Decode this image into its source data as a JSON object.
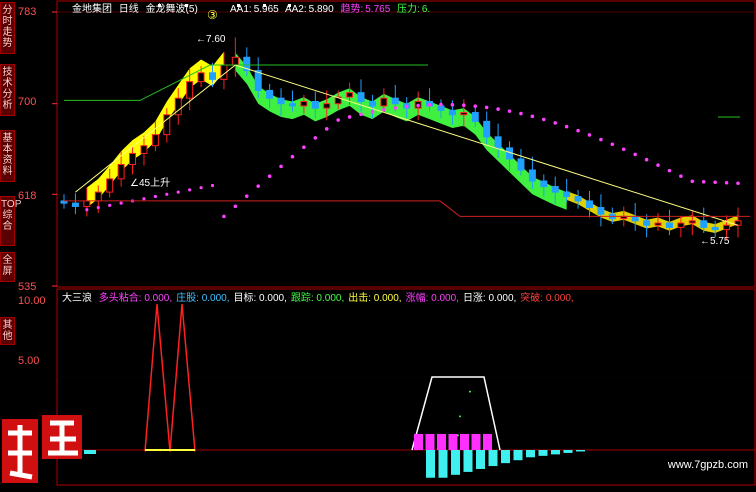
{
  "sidebar": {
    "tabs": [
      {
        "id": "fenshi",
        "label": "分时走势"
      },
      {
        "id": "jishu",
        "label": "技术分析"
      },
      {
        "id": "jiben",
        "label": "基本资料"
      },
      {
        "id": "top",
        "label": "TOP综合"
      },
      {
        "id": "quanping",
        "label": "全屏"
      },
      {
        "id": "qita",
        "label": "其他"
      }
    ]
  },
  "main_header": {
    "stock": "金地集团",
    "period": "日线",
    "indicator": "金龙舞波(5)",
    "aa1_label": "AA1:",
    "aa1_value": "5.965",
    "aa2_label": "AA2:",
    "aa2_value": "5.890",
    "trend_label": "趋势:",
    "trend_value": "5.765",
    "pressure_label": "压力:",
    "pressure_value": "6."
  },
  "sub_header": {
    "name": "大三浪",
    "items": [
      {
        "label": "多头粘合:",
        "value": "0.000",
        "color": "#ff40ff"
      },
      {
        "label": "庄股:",
        "value": "0.000",
        "color": "#40c0ff"
      },
      {
        "label": "目标:",
        "value": "0.000",
        "color": "#ffffff"
      },
      {
        "label": "跟踪:",
        "value": "0.000",
        "color": "#40ff40"
      },
      {
        "label": "出击:",
        "value": "0.000",
        "color": "#ffff40"
      },
      {
        "label": "涨幅:",
        "value": "0.000",
        "color": "#ff40ff"
      },
      {
        "label": "日涨:",
        "value": "0.000",
        "color": "#ffffff"
      },
      {
        "label": "突破:",
        "value": "0.000",
        "color": "#ff4040"
      }
    ]
  },
  "price_axis": {
    "ticks": [
      "783",
      "700",
      "618",
      "535"
    ],
    "ylim": [
      535,
      783
    ]
  },
  "sub_axis": {
    "ticks": [
      "10.00",
      "5.00"
    ],
    "ylim": [
      -2,
      10
    ]
  },
  "annotations": {
    "high": "←7.60",
    "low": "←5.75",
    "rise45": "∠45上升",
    "circle3": "③"
  },
  "watermark": "www.7gpzb.com",
  "logo_text": "股票"
}
